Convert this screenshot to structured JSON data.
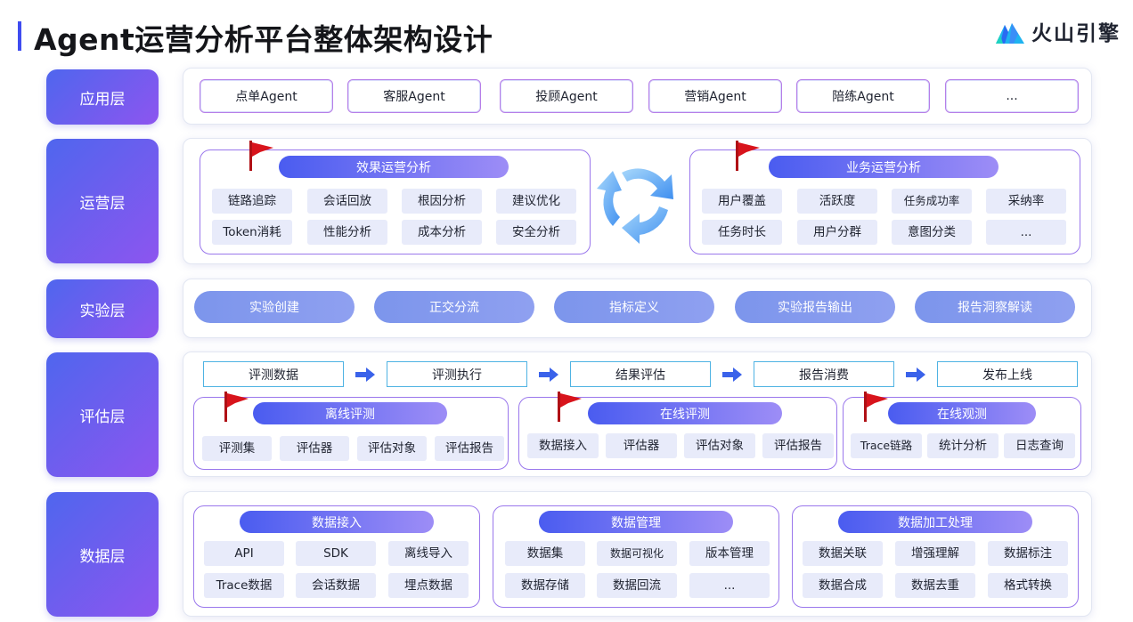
{
  "title": "Agent运营分析平台整体架构设计",
  "brand": {
    "name": "火山引擎",
    "logo_icon": "volcano-logo-icon"
  },
  "layers": {
    "app": {
      "label": "应用层",
      "items": [
        "点单Agent",
        "客服Agent",
        "投顾Agent",
        "营销Agent",
        "陪练Agent",
        "..."
      ]
    },
    "ops": {
      "label": "运营层",
      "effect": {
        "title": "效果运营分析",
        "items": [
          "链路追踪",
          "会话回放",
          "根因分析",
          "建议优化",
          "Token消耗",
          "性能分析",
          "成本分析",
          "安全分析"
        ]
      },
      "cycle_icon": "refresh-cycle-icon",
      "business": {
        "title": "业务运营分析",
        "items": [
          "用户覆盖",
          "活跃度",
          "任务成功率",
          "采纳率",
          "任务时长",
          "用户分群",
          "意图分类",
          "..."
        ]
      }
    },
    "experiment": {
      "label": "实验层",
      "items": [
        "实验创建",
        "正交分流",
        "指标定义",
        "实验报告输出",
        "报告洞察解读"
      ]
    },
    "eval": {
      "label": "评估层",
      "flow": [
        "评测数据",
        "评测执行",
        "结果评估",
        "报告消费",
        "发布上线"
      ],
      "offline": {
        "title": "离线评测",
        "items": [
          "评测集",
          "评估器",
          "评估对象",
          "评估报告"
        ]
      },
      "online": {
        "title": "在线评测",
        "items": [
          "数据接入",
          "评估器",
          "评估对象",
          "评估报告"
        ]
      },
      "observe": {
        "title": "在线观测",
        "items": [
          "Trace链路",
          "统计分析",
          "日志查询"
        ]
      }
    },
    "data": {
      "label": "数据层",
      "ingest": {
        "title": "数据接入",
        "items": [
          "API",
          "SDK",
          "离线导入",
          "Trace数据",
          "会话数据",
          "埋点数据"
        ]
      },
      "manage": {
        "title": "数据管理",
        "items": [
          "数据集",
          "数据可视化",
          "版本管理",
          "数据存储",
          "数据回流",
          "..."
        ]
      },
      "process": {
        "title": "数据加工处理",
        "items": [
          "数据关联",
          "增强理解",
          "数据标注",
          "数据合成",
          "数据去重",
          "格式转换"
        ]
      }
    }
  },
  "colors": {
    "accent": "#3f4cf0",
    "label_gradient_start": "#4f66ee",
    "label_gradient_end": "#8d55ef",
    "flag": "#d8141c",
    "flow_border": "#4fb3e3",
    "chip_bg": "#e8ebfa"
  }
}
